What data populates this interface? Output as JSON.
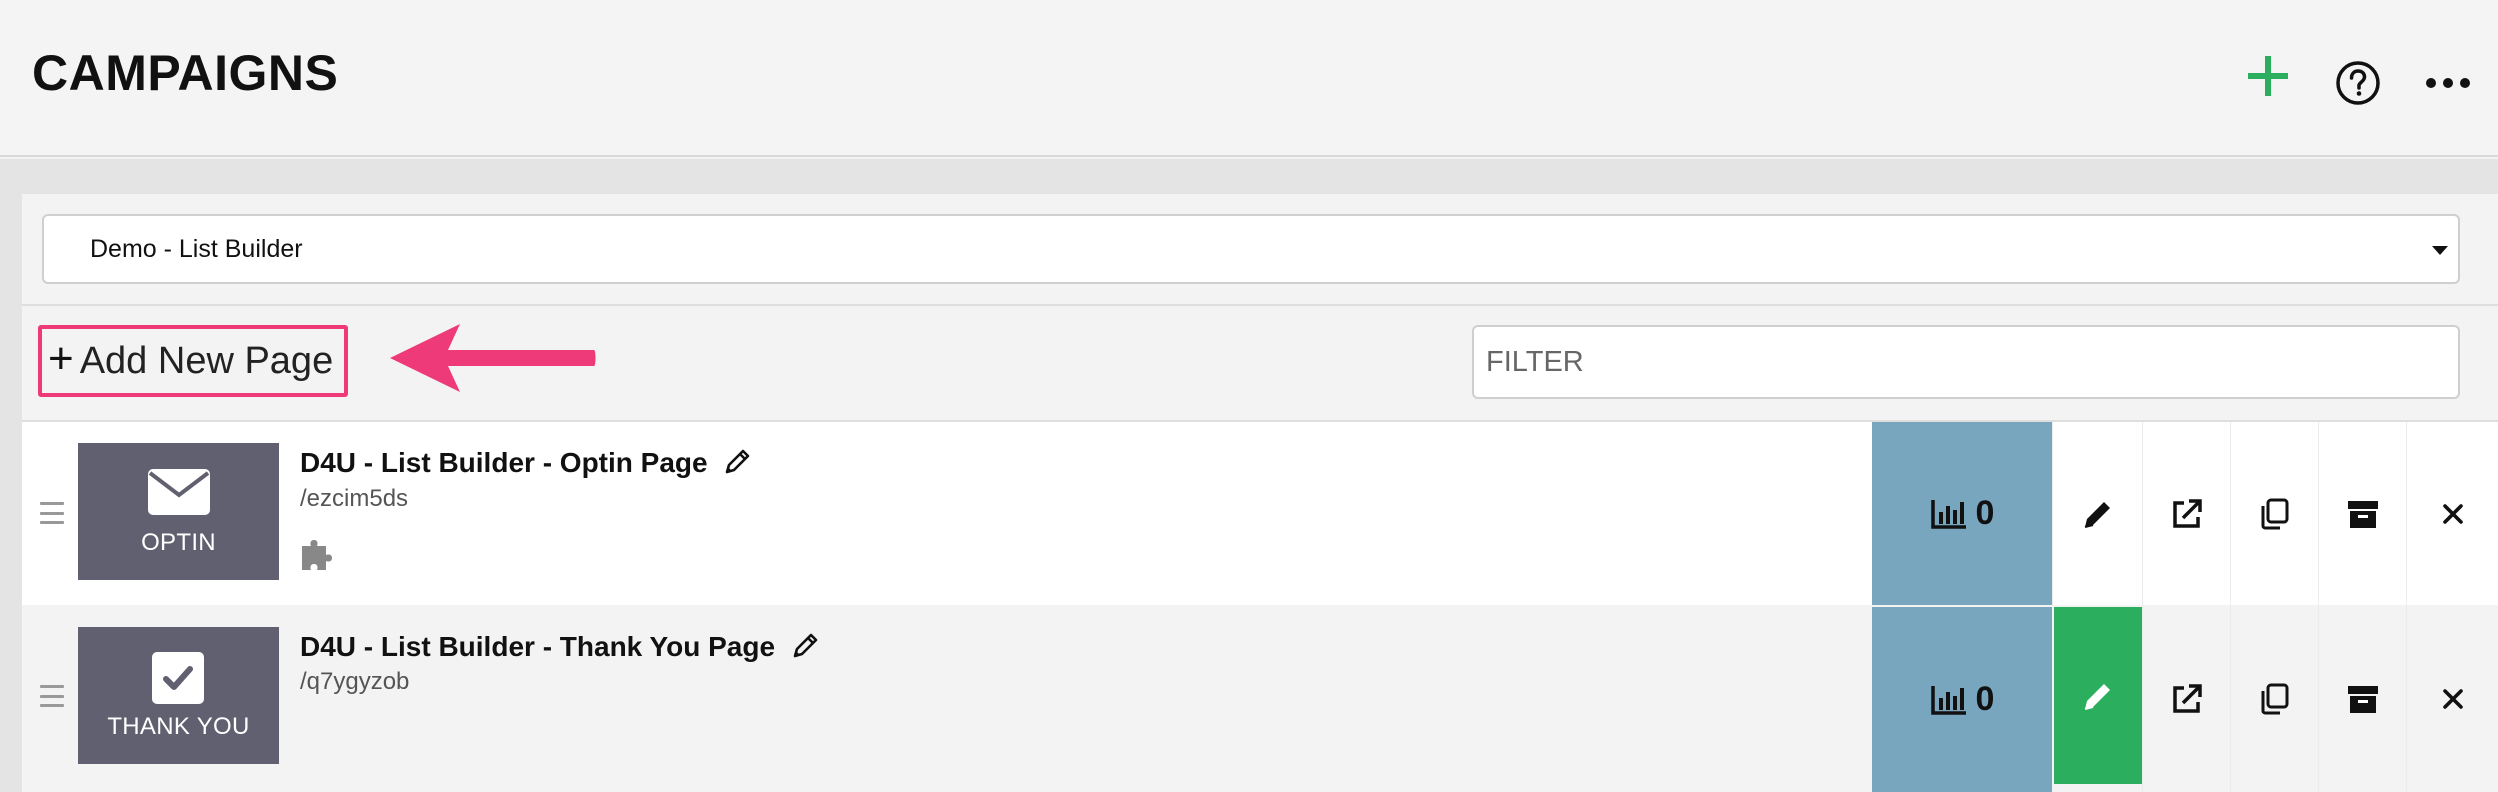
{
  "header": {
    "title": "CAMPAIGNS",
    "icons": [
      "plus-icon",
      "help-circle-icon",
      "more-horizontal-icon"
    ],
    "accent_color": "#2bae5e"
  },
  "campaign_select": {
    "selected": "Demo - List Builder"
  },
  "toolbar": {
    "add_page_label": "Add New Page",
    "filter_placeholder": "FILTER",
    "highlight_color": "#ee3a78"
  },
  "pages": [
    {
      "thumb_label": "OPTIN",
      "thumb_icon": "envelope-icon",
      "name": "D4U - List Builder - Optin Page",
      "slug": "/ezcim5ds",
      "stats_count": "0",
      "has_plugin_icon": true,
      "edit_active": false
    },
    {
      "thumb_label": "THANK YOU",
      "thumb_icon": "checkbox-icon",
      "name": "D4U - List Builder - Thank You Page",
      "slug": "/q7ygyzob",
      "stats_count": "0",
      "has_plugin_icon": false,
      "edit_active": true
    }
  ],
  "colors": {
    "stats_bg": "#78a6bf",
    "thumb_bg": "#606070",
    "edit_active_bg": "#2bae5e"
  }
}
